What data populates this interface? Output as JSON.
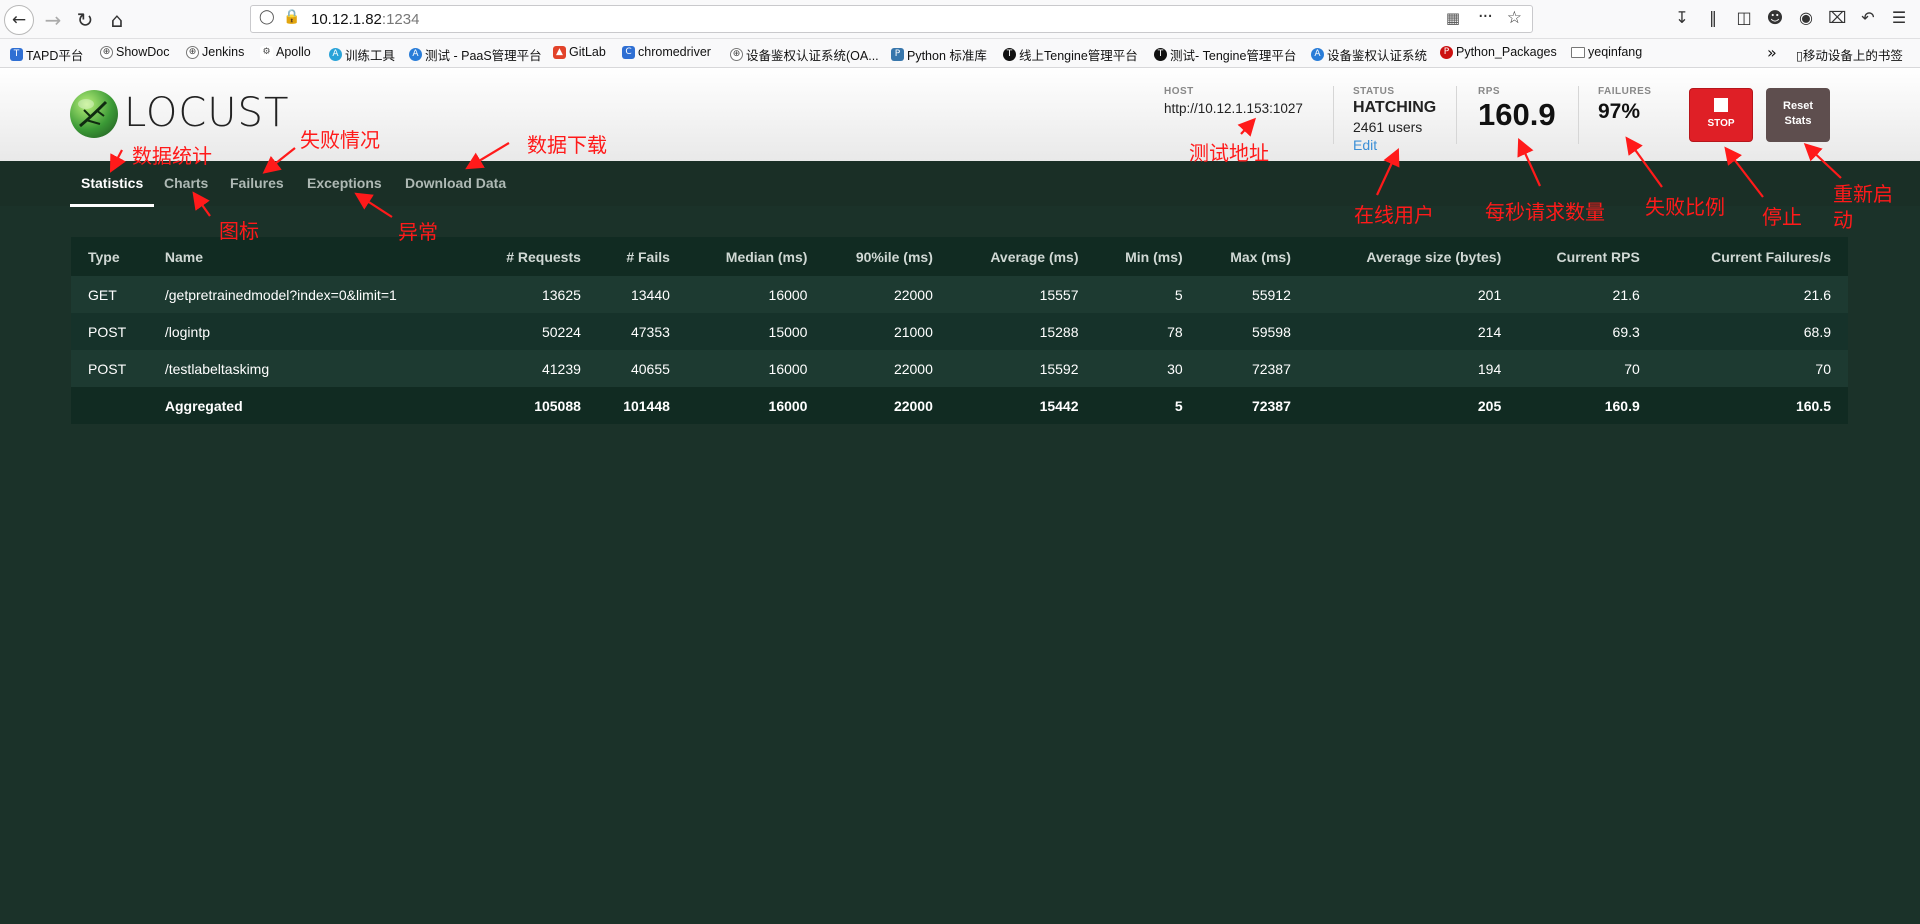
{
  "browser": {
    "url_host": "10.12.1.82",
    "url_port": ":1234",
    "bookmarks": [
      {
        "label": "TAPD平台",
        "color": "#2f6fd3"
      },
      {
        "label": "ShowDoc",
        "color": "#666666"
      },
      {
        "label": "Jenkins",
        "color": "#666666"
      },
      {
        "label": "Apollo",
        "color": "#444444"
      },
      {
        "label": "训练工具",
        "color": "#2aa3d8"
      },
      {
        "label": "测试 - PaaS管理平台",
        "color": "#2a7dd8"
      },
      {
        "label": "GitLab",
        "color": "#e2432a"
      },
      {
        "label": "chromedriver",
        "color": "#2f6fd3"
      },
      {
        "label": "设备鉴权认证系统(OA...",
        "color": "#666666"
      },
      {
        "label": "Python 标准库",
        "color": "#3776ab"
      },
      {
        "label": "线上Tengine管理平台",
        "color": "#111111"
      },
      {
        "label": "测试- Tengine管理平台",
        "color": "#111111"
      },
      {
        "label": "设备鉴权认证系统",
        "color": "#2a7dd8"
      },
      {
        "label": "Python_Packages",
        "color": "#cc1111"
      },
      {
        "label": "yeqinfang",
        "color": "#888888"
      }
    ],
    "mobile_bookmarks": "移动设备上的书签"
  },
  "header": {
    "logo_text": "LOCUST",
    "host_label": "HOST",
    "host_value": "http://10.12.1.153:1027",
    "status_label": "STATUS",
    "status_value": "HATCHING",
    "users_value": "2461 users",
    "edit_label": "Edit",
    "rps_label": "RPS",
    "rps_value": "160.9",
    "failures_label": "FAILURES",
    "failures_value": "97%",
    "stop_label": "STOP",
    "reset_label_line1": "Reset",
    "reset_label_line2": "Stats"
  },
  "tabs": [
    "Statistics",
    "Charts",
    "Failures",
    "Exceptions",
    "Download Data"
  ],
  "table": {
    "headers": [
      "Type",
      "Name",
      "# Requests",
      "# Fails",
      "Median (ms)",
      "90%ile (ms)",
      "Average (ms)",
      "Min (ms)",
      "Max (ms)",
      "Average size (bytes)",
      "Current RPS",
      "Current Failures/s"
    ],
    "rows": [
      [
        "GET",
        "/getpretrainedmodel?index=0&limit=1",
        "13625",
        "13440",
        "16000",
        "22000",
        "15557",
        "5",
        "55912",
        "201",
        "21.6",
        "21.6"
      ],
      [
        "POST",
        "/logintp",
        "50224",
        "47353",
        "15000",
        "21000",
        "15288",
        "78",
        "59598",
        "214",
        "69.3",
        "68.9"
      ],
      [
        "POST",
        "/testlabeltaskimg",
        "41239",
        "40655",
        "16000",
        "22000",
        "15592",
        "30",
        "72387",
        "194",
        "70",
        "70"
      ]
    ],
    "aggregated": [
      "",
      "Aggregated",
      "105088",
      "101448",
      "16000",
      "22000",
      "15442",
      "5",
      "72387",
      "205",
      "160.9",
      "160.5"
    ]
  },
  "annotations": {
    "stats": "数据统计",
    "failures": "失败情况",
    "download": "数据下载",
    "charts": "图标",
    "exceptions": "异常",
    "host": "测试地址",
    "users": "在线用户",
    "rps": "每秒请求数量",
    "fail_ratio": "失败比例",
    "stop": "停止",
    "reset_line1": "重新启",
    "reset_line2": "动"
  }
}
